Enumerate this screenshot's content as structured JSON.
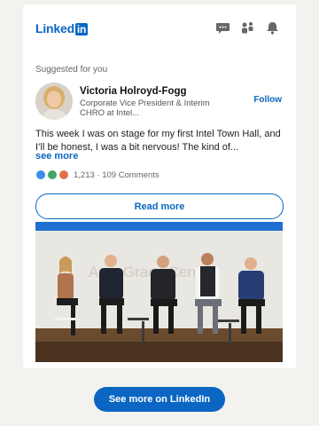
{
  "brand": {
    "logo_text": "Linked",
    "logo_in": "in"
  },
  "topbar": {
    "icons": [
      "messages-icon",
      "network-icon",
      "notifications-icon"
    ]
  },
  "feed": {
    "suggested_label": "Suggested for you",
    "author": {
      "name": "Victoria Holroyd-Fogg",
      "headline": "Corporate Vice President & Interim CHRO at Intel...",
      "follow_label": "Follow"
    },
    "post_text": "This week I was on stage for my first Intel Town Hall, and I’ll be honest, I was a bit nervous! The kind of...",
    "see_more_label": "see more",
    "reactions": {
      "counts_text": "1,213 · 109 Comments"
    },
    "read_more_label": "Read more",
    "media": {
      "stage_text": "Amy Grace Center"
    }
  },
  "cta": {
    "label": "See more on LinkedIn"
  },
  "colors": {
    "brand_blue": "#0a66c2",
    "page_bg": "#f3f2ef"
  }
}
